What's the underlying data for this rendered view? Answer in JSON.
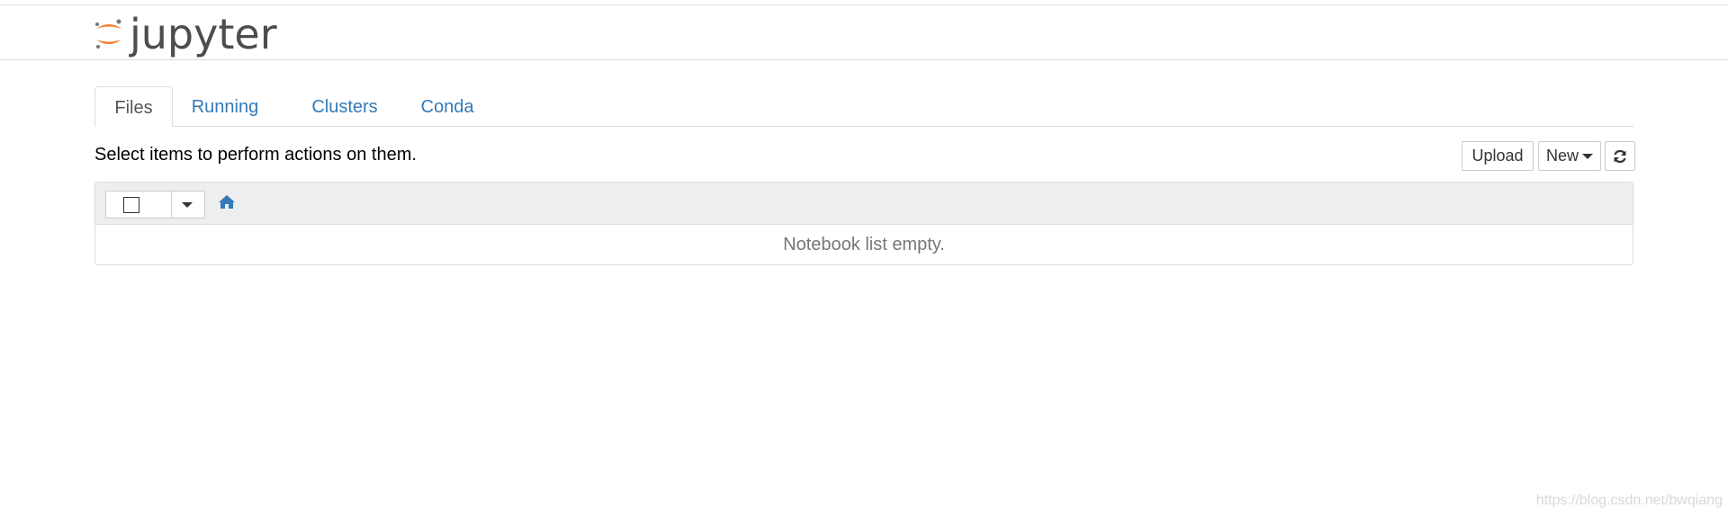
{
  "app": {
    "logo_text": "jupyter",
    "brand_color": "#f37726"
  },
  "tabs": [
    {
      "label": "Files",
      "active": true
    },
    {
      "label": "Running",
      "active": false
    },
    {
      "label": "Clusters",
      "active": false
    },
    {
      "label": "Conda",
      "active": false
    }
  ],
  "toolbar": {
    "hint": "Select items to perform actions on them.",
    "upload_label": "Upload",
    "new_label": "New",
    "refresh_icon": "refresh-icon"
  },
  "file_list": {
    "select_all_checked": false,
    "home_icon": "home-icon",
    "empty_message": "Notebook list empty."
  },
  "watermark": "https://blog.csdn.net/bwqiang",
  "colors": {
    "link": "#337ab7",
    "active_tab_text": "#555555",
    "list_header_bg": "#eeeeee",
    "empty_text": "#777777"
  }
}
